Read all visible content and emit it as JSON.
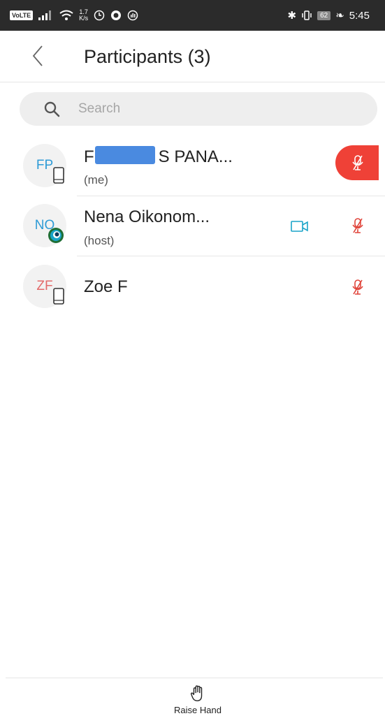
{
  "status_bar": {
    "volte": "VoLTE",
    "speed_value": "1.7",
    "speed_unit": "K/s",
    "battery": "62",
    "time": "5:45"
  },
  "header": {
    "title": "Participants (3)"
  },
  "search": {
    "placeholder": "Search",
    "value": ""
  },
  "participants": [
    {
      "initials": "FP",
      "initials_color": "#2e9bd6",
      "name_prefix": "F",
      "name_suffix": "S PANA...",
      "role": "(me)",
      "device": "phone-icon",
      "mic": "muted-active",
      "video": false
    },
    {
      "initials": "NO",
      "initials_color": "#2e9bd6",
      "name": "Nena Oikonom...",
      "role": "(host)",
      "device": "webex-app-icon",
      "mic": "muted",
      "video": true
    },
    {
      "initials": "ZF",
      "initials_color": "#e36a6a",
      "name": "Zoe F",
      "role": "",
      "device": "phone-icon",
      "mic": "muted",
      "video": false
    }
  ],
  "footer": {
    "raise_hand_label": "Raise Hand"
  },
  "colors": {
    "accent_red": "#ef4137",
    "accent_teal": "#1aa4c8",
    "muted_mic_red": "#e0443a"
  }
}
